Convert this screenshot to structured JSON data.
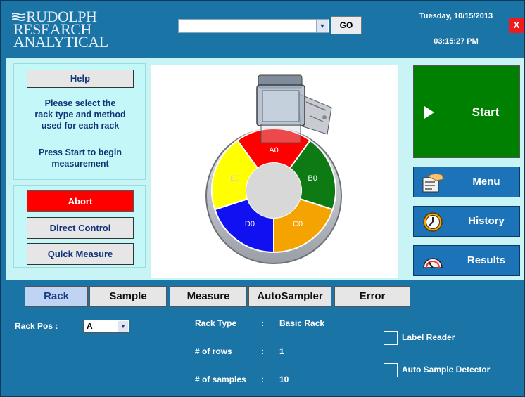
{
  "header": {
    "logo_lines": [
      "RUDOLPH",
      "RESEARCH",
      "ANALYTICAL"
    ],
    "dropdown_value": "",
    "go_label": "GO",
    "date": "Tuesday, 10/15/2013",
    "time": "03:15:27 PM",
    "close_label": "X"
  },
  "left": {
    "help_label": "Help",
    "help_text": [
      "Please select the",
      "rack type and method",
      "used for each rack",
      "",
      "Press Start to begin",
      "measurement"
    ],
    "abort_label": "Abort",
    "direct_control_label": "Direct Control",
    "quick_measure_label": "Quick Measure"
  },
  "carousel": {
    "segments": [
      {
        "label": "A0",
        "color": "#ff0000"
      },
      {
        "label": "B0",
        "color": "#0d7a14"
      },
      {
        "label": "C0",
        "color": "#f5a300"
      },
      {
        "label": "D0",
        "color": "#1010f0"
      },
      {
        "label": "E0",
        "color": "#ffff00"
      }
    ]
  },
  "right": {
    "start_label": "Start",
    "menu_label": "Menu",
    "history_label": "History",
    "results_label": "Results"
  },
  "tabs": [
    {
      "label": "Rack",
      "active": true
    },
    {
      "label": "Sample",
      "active": false
    },
    {
      "label": "Measure",
      "active": false
    },
    {
      "label": "AutoSampler",
      "active": false
    },
    {
      "label": "Error",
      "active": false
    }
  ],
  "rack": {
    "rack_pos_label": "Rack Pos  :",
    "rack_pos_value": "A",
    "rack_type_label": "Rack Type",
    "rack_type_value": "Basic Rack",
    "rows_label": "# of rows",
    "rows_value": "1",
    "samples_label": "# of samples",
    "samples_value": "10",
    "sep": ":",
    "label_reader_label": "Label Reader",
    "label_reader_checked": false,
    "auto_sample_label": "Auto Sample Detector",
    "auto_sample_checked": false
  }
}
